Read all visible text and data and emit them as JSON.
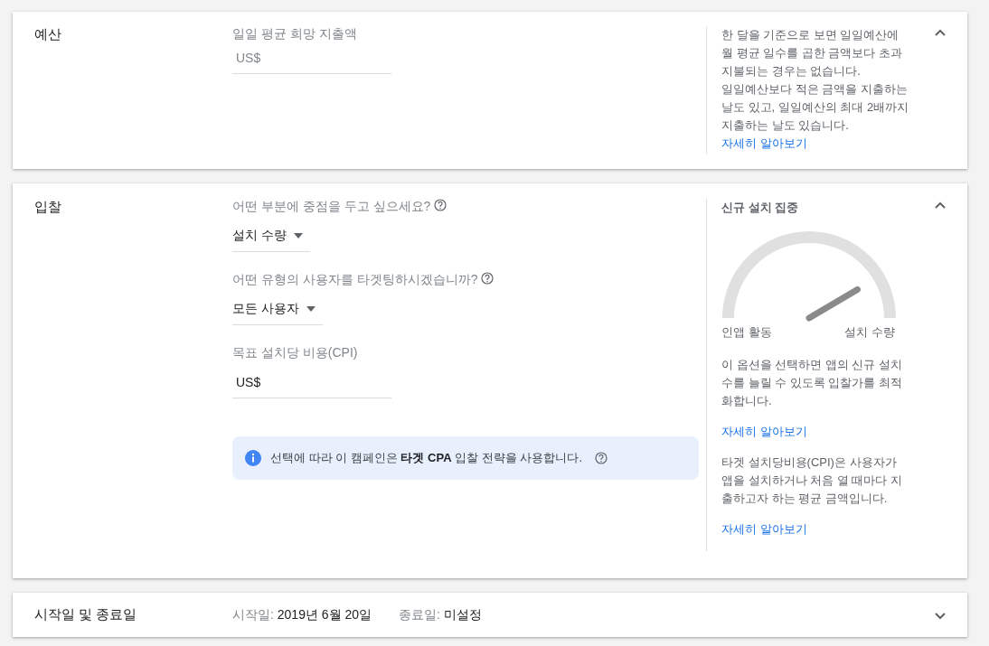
{
  "budget": {
    "title": "예산",
    "expanded": true,
    "field": {
      "label": "일일 평균 희망 지출액",
      "placeholder": "US$"
    },
    "help": [
      {
        "text": "한 달을 기준으로 보면 일일예산에 월 평균 일수를 곱한 금액보다 초과 지불되는 경우는 없습니다."
      },
      {
        "text": "일일예산보다 적은 금액을 지출하는 날도 있고, 일일예산의 최대 2배까지 지출하는 날도 있습니다.",
        "link": "자세히 알아보기"
      }
    ]
  },
  "bidding": {
    "title": "입찰",
    "expanded": true,
    "questions": [
      {
        "label": "어떤 부분에 중점을 두고 싶으세요?",
        "value": "설치 수량"
      },
      {
        "label": "어떤 유형의 사용자를 타겟팅하시겠습니까?",
        "value": "모든 사용자"
      }
    ],
    "cpi_field": {
      "label": "목표 설치당 비용(CPI)",
      "value": "US$"
    },
    "info": "선택에 따라 이 캠페인은 **타겟 CPA** 입찰 전략을 사용합니다.",
    "side": {
      "title": "신규 설치 집중",
      "gauge": {
        "left_label": "인앱 활동",
        "right_label": "설치 수량"
      },
      "help": [
        {
          "text": "이 옵션을 선택하면 앱의 신규 설치 수를 늘릴 수 있도록 입찰가를 최적화합니다.",
          "link": "자세히 알아보기"
        },
        {
          "text": "타겟 설치당비용(CPI)은 사용자가 앱을 설치하거나 처음 열 때마다 지출하고자 하는 평균 금액입니다.",
          "link": "자세히 알아보기"
        }
      ]
    }
  },
  "dates": {
    "title": "시작일 및 종료일",
    "expanded": false,
    "items": [
      {
        "label": "시작일:",
        "value": "2019년 6월 20일"
      },
      {
        "label": "종료일:",
        "value": "미설정"
      }
    ]
  }
}
